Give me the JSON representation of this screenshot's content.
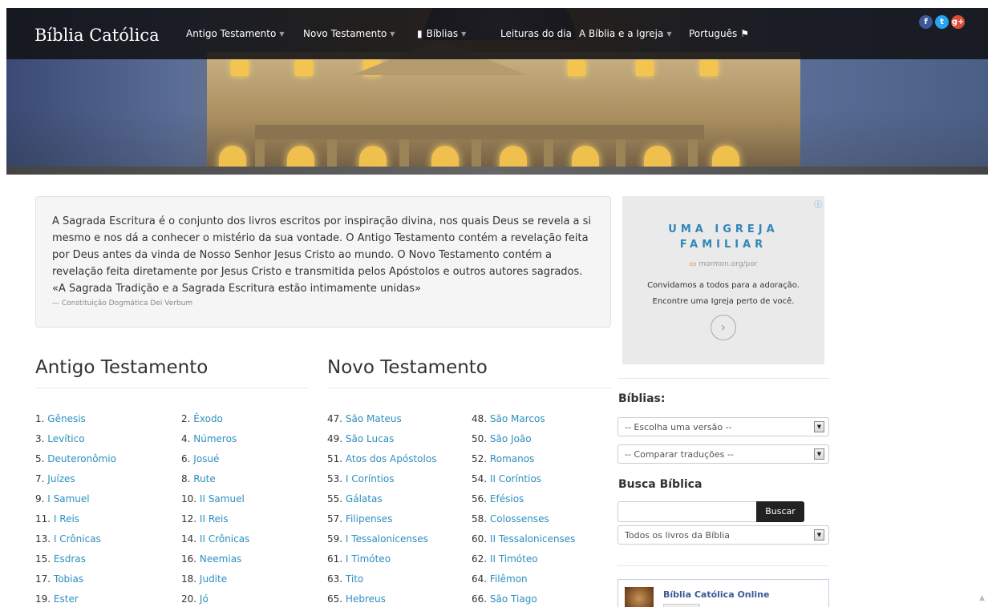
{
  "header": {
    "brand": "Bíblia Católica",
    "nav": [
      {
        "label": "Antigo Testamento",
        "dropdown": true
      },
      {
        "label": "Novo Testamento",
        "dropdown": true
      },
      {
        "label": "Bíblias",
        "dropdown": true,
        "icon": "book-icon"
      },
      {
        "label": "Leituras do dia",
        "dropdown": false
      },
      {
        "label": "A Bíblia e a Igreja",
        "dropdown": true
      },
      {
        "label": "Português",
        "dropdown": false,
        "icon": "flag-icon"
      }
    ],
    "social": [
      {
        "icon": "facebook-icon",
        "glyph": "f",
        "color": "#3b5998"
      },
      {
        "icon": "twitter-icon",
        "glyph": "t",
        "color": "#2aa3ef"
      },
      {
        "icon": "google-plus-icon",
        "glyph": "g+",
        "color": "#dd4b39"
      }
    ]
  },
  "intro": {
    "text": "A Sagrada Escritura é o conjunto dos livros escritos por inspiração divina, nos quais Deus se revela a si mesmo e nos dá a conhecer o mistério da sua vontade. O Antigo Testamento contém a revelação feita por Deus antes da vinda de Nosso Senhor Jesus Cristo ao mundo. O Novo Testamento contém a revelação feita diretamente por Jesus Cristo e transmitida pelos Apóstolos e outros autores sagrados. «A Sagrada Tradição e a Sagrada Escritura estão intimamente unidas»",
    "source": "— Constituição Dogmática Dei Verbum"
  },
  "ad": {
    "title_line1": "UMA IGREJA",
    "title_line2": "FAMILIAR",
    "url": "mormon.org/por",
    "text_line1": "Convidamos a todos para a adoração.",
    "text_line2": "Encontre uma Igreja perto de você."
  },
  "old_testament": {
    "heading": "Antigo Testamento",
    "books": [
      {
        "num": "1.",
        "name": "Gênesis"
      },
      {
        "num": "2.",
        "name": "Êxodo"
      },
      {
        "num": "3.",
        "name": "Levítico"
      },
      {
        "num": "4.",
        "name": "Números"
      },
      {
        "num": "5.",
        "name": "Deuteronômio"
      },
      {
        "num": "6.",
        "name": "Josué"
      },
      {
        "num": "7.",
        "name": "Juízes"
      },
      {
        "num": "8.",
        "name": "Rute"
      },
      {
        "num": "9.",
        "name": "I Samuel"
      },
      {
        "num": "10.",
        "name": "II Samuel"
      },
      {
        "num": "11.",
        "name": "I Reis"
      },
      {
        "num": "12.",
        "name": "II Reis"
      },
      {
        "num": "13.",
        "name": "I Crônicas"
      },
      {
        "num": "14.",
        "name": "II Crônicas"
      },
      {
        "num": "15.",
        "name": "Esdras"
      },
      {
        "num": "16.",
        "name": "Neemias"
      },
      {
        "num": "17.",
        "name": "Tobias"
      },
      {
        "num": "18.",
        "name": "Judite"
      },
      {
        "num": "19.",
        "name": "Ester"
      },
      {
        "num": "20.",
        "name": "Jó"
      }
    ]
  },
  "new_testament": {
    "heading": "Novo Testamento",
    "books": [
      {
        "num": "47.",
        "name": "São Mateus"
      },
      {
        "num": "48.",
        "name": "São Marcos"
      },
      {
        "num": "49.",
        "name": "São Lucas"
      },
      {
        "num": "50.",
        "name": "São João"
      },
      {
        "num": "51.",
        "name": "Atos dos Apóstolos"
      },
      {
        "num": "52.",
        "name": "Romanos"
      },
      {
        "num": "53.",
        "name": "I Coríntios"
      },
      {
        "num": "54.",
        "name": "II Coríntios"
      },
      {
        "num": "55.",
        "name": "Gálatas"
      },
      {
        "num": "56.",
        "name": "Efésios"
      },
      {
        "num": "57.",
        "name": "Filipenses"
      },
      {
        "num": "58.",
        "name": "Colossenses"
      },
      {
        "num": "59.",
        "name": "I Tessalonicenses"
      },
      {
        "num": "60.",
        "name": "II Tessalonicenses"
      },
      {
        "num": "61.",
        "name": "I Timóteo"
      },
      {
        "num": "62.",
        "name": "II Timóteo"
      },
      {
        "num": "63.",
        "name": "Tito"
      },
      {
        "num": "64.",
        "name": "Filêmon"
      },
      {
        "num": "65.",
        "name": "Hebreus"
      },
      {
        "num": "66.",
        "name": "São Tiago"
      }
    ]
  },
  "sidebar": {
    "biblias_label": "Bíblias:",
    "version_select": "-- Escolha uma versão --",
    "compare_select": "-- Comparar traduções --",
    "search_label": "Busca Bíblica",
    "search_value": "",
    "search_button": "Buscar",
    "scope_select": "Todos os livros da Bíblia",
    "facebook_page": "Bíblia Católica Online"
  },
  "colors": {
    "link": "#2c8fbf",
    "navbar": "#121216",
    "ad_title": "#2f87b8"
  }
}
